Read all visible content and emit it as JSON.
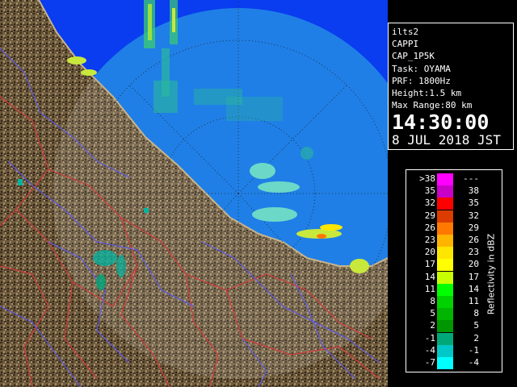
{
  "info": {
    "site": "ilts2",
    "product": "CAPPI",
    "scan": "CAP_1P5K",
    "task": "Task: OYAMA",
    "prf": "PRF: 1800Hz",
    "height": "Height:1.5 km",
    "max_range": "Max Range:80 km",
    "time": "14:30:00",
    "date": "8 JUL 2018 JST"
  },
  "legend": {
    "unit_label": "Reflectivity in dBZ",
    "rows": [
      {
        "lo": ">38",
        "hi": "---",
        "color": "#ff00ff"
      },
      {
        "lo": "35",
        "hi": "38",
        "color": "#c800c8"
      },
      {
        "lo": "32",
        "hi": "35",
        "color": "#ff0000"
      },
      {
        "lo": "29",
        "hi": "32",
        "color": "#dc3c00"
      },
      {
        "lo": "26",
        "hi": "29",
        "color": "#ff7800"
      },
      {
        "lo": "23",
        "hi": "26",
        "color": "#ffb400"
      },
      {
        "lo": "20",
        "hi": "23",
        "color": "#ffe600"
      },
      {
        "lo": "17",
        "hi": "20",
        "color": "#ffff00"
      },
      {
        "lo": "14",
        "hi": "17",
        "color": "#c8ff00"
      },
      {
        "lo": "11",
        "hi": "14",
        "color": "#00ff00"
      },
      {
        "lo": "8",
        "hi": "11",
        "color": "#00d200"
      },
      {
        "lo": "5",
        "hi": "8",
        "color": "#00b400"
      },
      {
        "lo": "2",
        "hi": "5",
        "color": "#009600"
      },
      {
        "lo": "-1",
        "hi": "2",
        "color": "#00a878"
      },
      {
        "lo": "-4",
        "hi": "-1",
        "color": "#00c8c8"
      },
      {
        "lo": "-7",
        "hi": "-4",
        "color": "#00ffff"
      }
    ]
  },
  "colors": {
    "sea": "#0a3cf0",
    "radar_range": "#1f7fe6",
    "land": "#6e5a3c",
    "border_red": "#d23c3c",
    "river_blue": "#5a5aff"
  }
}
